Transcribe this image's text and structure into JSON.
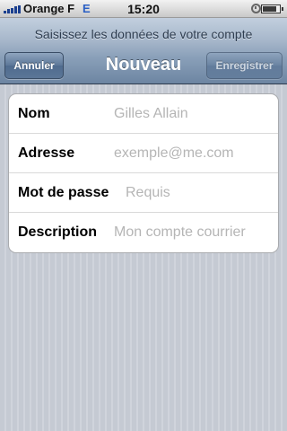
{
  "status_bar": {
    "carrier": "Orange F",
    "network": "E",
    "time": "15:20",
    "signal_bars": 5,
    "battery_level": 0.85
  },
  "nav": {
    "prompt": "Saisissez les données de votre compte",
    "title": "Nouveau",
    "cancel_label": "Annuler",
    "save_label": "Enregistrer"
  },
  "form": {
    "fields": [
      {
        "label": "Nom",
        "placeholder": "Gilles Allain",
        "value": ""
      },
      {
        "label": "Adresse",
        "placeholder": "exemple@me.com",
        "value": ""
      },
      {
        "label": "Mot de passe",
        "placeholder": "Requis",
        "value": ""
      },
      {
        "label": "Description",
        "placeholder": "Mon compte courrier",
        "value": ""
      }
    ]
  },
  "colors": {
    "nav_title": "#ffffff",
    "placeholder": "#b5b5b5",
    "background": "#c7ccd5"
  }
}
